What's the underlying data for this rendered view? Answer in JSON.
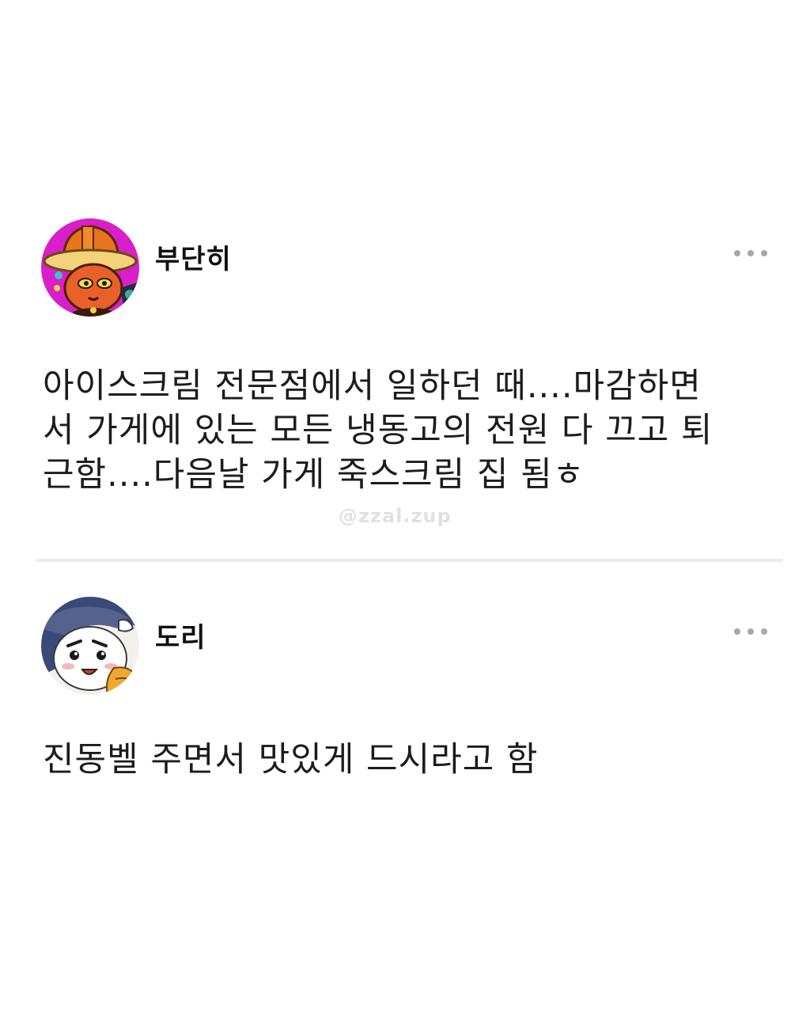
{
  "posts": [
    {
      "username": "부단히",
      "text_lines": [
        "아이스크림 전문점에서 일하던 때....마감하면",
        "서 가게에 있는 모든 냉동고의 전원 다 끄고 퇴",
        "근함....다음날 가게 죽스크림 집 됨ㅎ"
      ],
      "avatar_icon": "cat-in-hat-avatar",
      "more_icon": "more-options-icon"
    },
    {
      "username": "도리",
      "text_lines": [
        "진동벨 주면서 맛있게 드시라고 함"
      ],
      "avatar_icon": "cartoon-character-avatar",
      "more_icon": "more-options-icon"
    }
  ],
  "watermark": "@zzal.zup",
  "colors": {
    "background": "#ffffff",
    "divider": "#ececec",
    "more_dots": "#a8a8a8",
    "text": "#1c1c1c"
  }
}
